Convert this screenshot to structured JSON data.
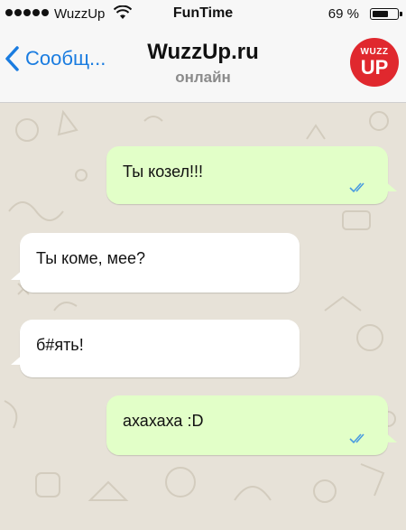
{
  "status_bar": {
    "carrier": "WuzzUp",
    "time": "FunTime",
    "battery_percent_label": "69 %",
    "battery_level": 0.69
  },
  "nav": {
    "back_label": "Сообщ...",
    "title": "WuzzUp.ru",
    "subtitle": "онлайн",
    "avatar_top": "WUZZ",
    "avatar_bottom": "UP"
  },
  "messages": [
    {
      "direction": "outgoing",
      "text": "Ты козел!!!",
      "read": true
    },
    {
      "direction": "incoming",
      "text": "Ты коме, мее?"
    },
    {
      "direction": "incoming",
      "text": "б#ять!"
    },
    {
      "direction": "outgoing",
      "text": "ахахаха :D",
      "read": true
    }
  ],
  "colors": {
    "accent": "#1a7ce0",
    "outgoing_bubble": "#e2ffc8",
    "incoming_bubble": "#ffffff",
    "chat_background": "#e7e2d8",
    "read_ticks": "#4a9be0",
    "avatar": "#e0282e"
  }
}
